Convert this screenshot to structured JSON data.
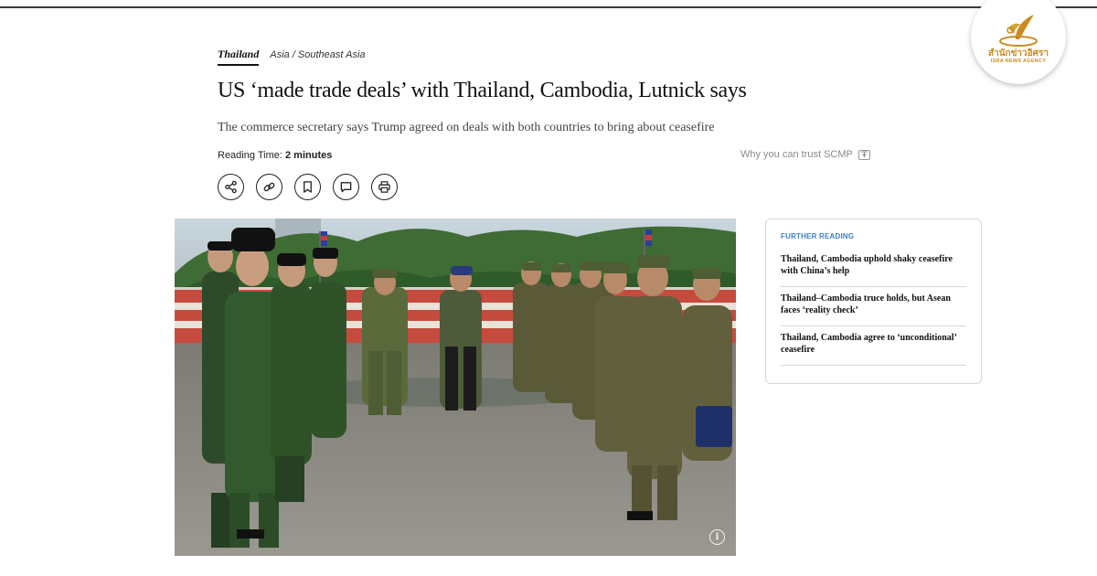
{
  "breadcrumb": {
    "primary": "Thailand",
    "secondary": "Asia / Southeast Asia"
  },
  "article": {
    "headline": "US ‘made trade deals’ with Thailand, Cambodia, Lutnick says",
    "subheadline": "The commerce secretary says Trump agreed on deals with both countries to bring about ceasefire",
    "reading_time_label": "Reading Time:",
    "reading_time_value": "2 minutes",
    "trust_link": "Why you can trust SCMP"
  },
  "actions": [
    {
      "name": "share-button",
      "icon": "share-icon"
    },
    {
      "name": "copy-link-button",
      "icon": "link-icon"
    },
    {
      "name": "bookmark-button",
      "icon": "bookmark-icon"
    },
    {
      "name": "comment-button",
      "icon": "comment-icon"
    },
    {
      "name": "print-button",
      "icon": "printer-icon"
    }
  ],
  "hero_image": {
    "info_icon": "i"
  },
  "further_reading": {
    "title": "FURTHER READING",
    "items": [
      "Thailand, Cambodia uphold shaky ceasefire with China’s help",
      "Thailand–Cambodia truce holds, but Asean faces ‘reality check’",
      "Thailand, Cambodia agree to ‘unconditional’ ceasefire"
    ]
  },
  "watermark": {
    "thai": "สำนักข่าวอิศรา",
    "english": "ISRA NEWS AGENCY"
  },
  "colors": {
    "further_reading_label": "#3f7fc4",
    "logo_gold": "#c98b1e",
    "text": "#111111"
  }
}
